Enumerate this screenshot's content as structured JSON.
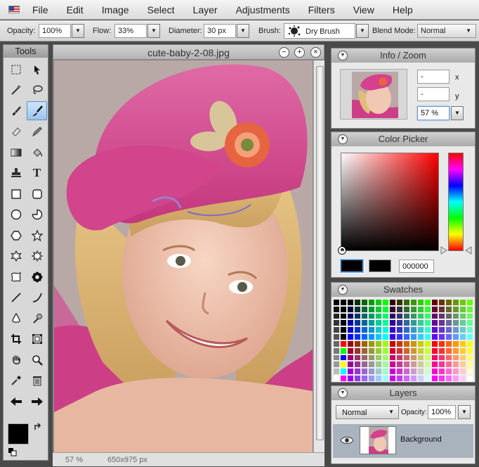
{
  "menubar": {
    "items": [
      "File",
      "Edit",
      "Image",
      "Select",
      "Layer",
      "Adjustments",
      "Filters",
      "View",
      "Help"
    ]
  },
  "options": {
    "opacity_label": "Opacity:",
    "opacity_value": "100%",
    "flow_label": "Flow:",
    "flow_value": "33%",
    "diameter_label": "Diameter:",
    "diameter_value": "30 px",
    "brush_label": "Brush:",
    "brush_value": "Dry Brush",
    "blend_label": "Blend Mode:",
    "blend_value": "Normal"
  },
  "tools": {
    "title": "Tools",
    "items": [
      "marquee",
      "move",
      "magic-wand",
      "lasso",
      "brush",
      "smudge",
      "eraser",
      "pencil",
      "gradient",
      "bucket",
      "stamp",
      "text",
      "rectangle",
      "rounded-rectangle",
      "ellipse",
      "pie",
      "hexagon",
      "star",
      "star-6",
      "star-8",
      "blob",
      "flower",
      "line",
      "curve",
      "drop",
      "dodge",
      "crop",
      "resize",
      "hand",
      "zoom",
      "eyedropper",
      "trash",
      "undo",
      "redo"
    ],
    "active": "smudge"
  },
  "canvas": {
    "filename": "cute-baby-2-08.jpg",
    "zoom_status": "57 %",
    "size_status": "650x975 px"
  },
  "info_panel": {
    "title": "Info / Zoom",
    "x_label": "x",
    "y_label": "y",
    "x_value": "-",
    "y_value": "-",
    "zoom_value": "57 %"
  },
  "color_picker": {
    "title": "Color Picker",
    "hex_value": "000000"
  },
  "swatches": {
    "title": "Swatches"
  },
  "layers": {
    "title": "Layers",
    "blend_value": "Normal",
    "opacity_label": "Opacity:",
    "opacity_value": "100%",
    "layer_name": "Background"
  },
  "colors": {
    "accent": "#5c8fc8",
    "hat": "#d6408e",
    "shirt": "#cc3f86"
  }
}
